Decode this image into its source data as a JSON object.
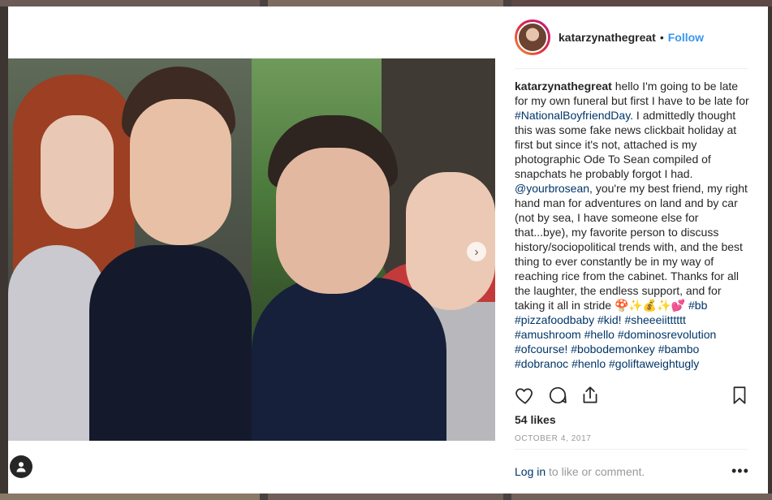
{
  "post": {
    "username": "katarzynathegreat",
    "separator": "•",
    "follow_label": "Follow"
  },
  "caption": {
    "username": "katarzynathegreat",
    "text1": " hello I'm going to be late for my own funeral but first I have to be late for ",
    "tag_national": "#NationalBoyfriendDay",
    "text2": ". I admittedly thought this was some fake news clickbait holiday at first but since it's not, attached is my photographic Ode To Sean compiled of snapchats he probably forgot I had. ",
    "mention": "@yourbrosean",
    "text3": ", you're my best friend, my right hand man for adventures on land and by car (not by sea, I have someone else for that...bye), my favorite person to discuss history/sociopolitical trends with, and the best thing to ever constantly be in my way of reaching rice from the cabinet. Thanks for all the laughter, the endless support, and for taking it all in stride 🍄✨💰✨💕",
    "hashtags": [
      "#bb",
      "#pizzafoodbaby",
      "#kid!",
      "#sheeeiitttttt",
      "#amushroom",
      "#hello",
      "#dominosrevolution",
      "#ofcourse!",
      "#bobodemonkey",
      "#bambo",
      "#dobranoc",
      "#henlo",
      "#goliftaweightugly"
    ]
  },
  "stats": {
    "likes": "54 likes",
    "date": "OCTOBER 4, 2017"
  },
  "footer": {
    "login_label": "Log in",
    "rest": " to like or comment.",
    "more": "•••"
  },
  "carousel": {
    "next_icon": "›"
  },
  "icons": {
    "like": "heart-icon",
    "comment": "comment-icon",
    "share": "share-icon",
    "save": "bookmark-icon",
    "user": "user-icon"
  },
  "colors": {
    "link": "#003569",
    "follow": "#3897f0",
    "muted": "#999999",
    "text": "#262626"
  }
}
